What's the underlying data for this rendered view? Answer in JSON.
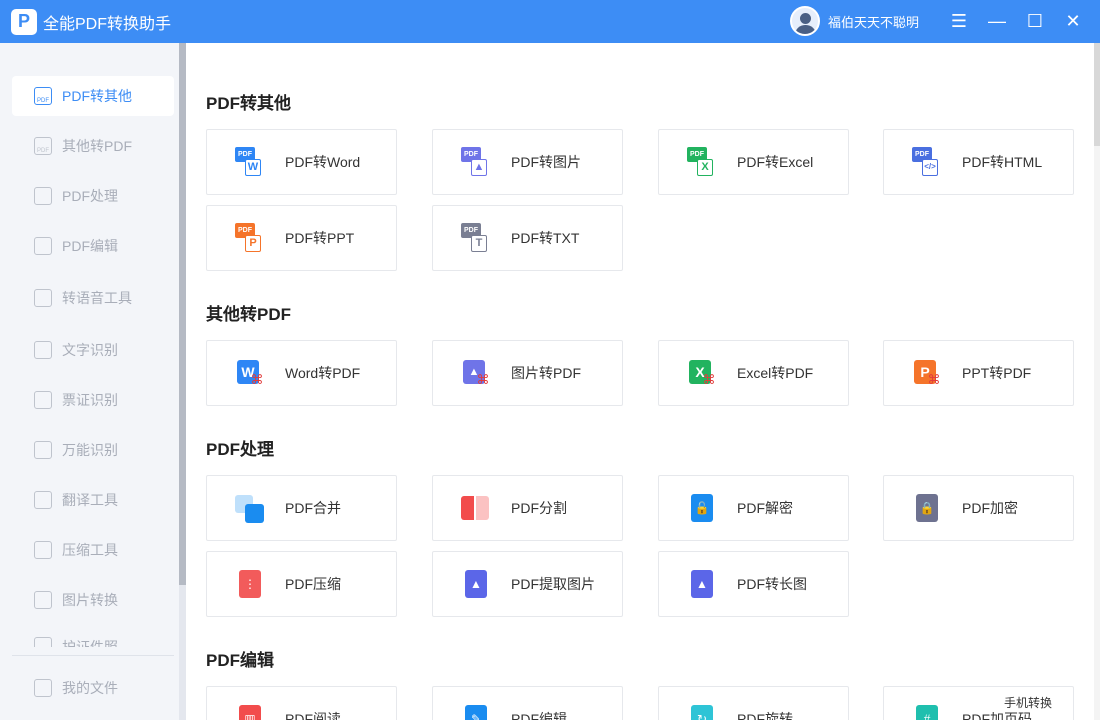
{
  "app": {
    "title": "全能PDF转换助手",
    "logo_letter": "P",
    "accent": "#3d8df5"
  },
  "user": {
    "name": "福伯天天不聪明"
  },
  "window_controls": {
    "menu": "☰",
    "minimize": "—",
    "maximize": "☐",
    "close": "✕"
  },
  "sidebar": {
    "items": [
      {
        "label": "PDF转其他",
        "icon": "pdf-to-other-icon",
        "glyph": "PDF",
        "active": true
      },
      {
        "label": "其他转PDF",
        "icon": "other-to-pdf-icon",
        "glyph": "PDF"
      },
      {
        "label": "PDF处理",
        "icon": "pdf-process-icon",
        "glyph": ""
      },
      {
        "label": "PDF编辑",
        "icon": "pdf-edit-icon",
        "glyph": ""
      },
      {
        "label": "转语音工具",
        "icon": "voice-tool-icon",
        "glyph": ""
      },
      {
        "label": "文字识别",
        "icon": "text-ocr-icon",
        "glyph": ""
      },
      {
        "label": "票证识别",
        "icon": "ticket-ocr-icon",
        "glyph": ""
      },
      {
        "label": "万能识别",
        "icon": "universal-ocr-icon",
        "glyph": ""
      },
      {
        "label": "翻译工具",
        "icon": "translate-icon",
        "glyph": ""
      },
      {
        "label": "压缩工具",
        "icon": "compress-icon",
        "glyph": ""
      },
      {
        "label": "图片转换",
        "icon": "image-convert-icon",
        "glyph": ""
      },
      {
        "label": "护证件照",
        "icon": "id-photo-icon",
        "glyph": ""
      }
    ],
    "my_files": "我的文件"
  },
  "sections": [
    {
      "title": "PDF转其他",
      "cards": [
        {
          "label": "PDF转Word",
          "icon": "pdf-to-word-icon",
          "tag": "PDF",
          "sub": "W",
          "color": "#2e86f5"
        },
        {
          "label": "PDF转图片",
          "icon": "pdf-to-image-icon",
          "tag": "PDF",
          "sub": "▲",
          "color": "#6f74e8"
        },
        {
          "label": "PDF转Excel",
          "icon": "pdf-to-excel-icon",
          "tag": "PDF",
          "sub": "X",
          "color": "#22b35f"
        },
        {
          "label": "PDF转HTML",
          "icon": "pdf-to-html-icon",
          "tag": "PDF",
          "sub": "</>",
          "color": "#4a6fe0"
        },
        {
          "label": "PDF转PPT",
          "icon": "pdf-to-ppt-icon",
          "tag": "PDF",
          "sub": "P",
          "color": "#f5742a"
        },
        {
          "label": "PDF转TXT",
          "icon": "pdf-to-txt-icon",
          "tag": "PDF",
          "sub": "T",
          "color": "#7a7f93"
        }
      ]
    },
    {
      "title": "其他转PDF",
      "cards": [
        {
          "label": "Word转PDF",
          "icon": "word-to-pdf-icon",
          "tag": "W",
          "color": "#2e86f5"
        },
        {
          "label": "图片转PDF",
          "icon": "image-to-pdf-icon",
          "tag": "▲",
          "color": "#6f74e8"
        },
        {
          "label": "Excel转PDF",
          "icon": "excel-to-pdf-icon",
          "tag": "X",
          "color": "#22b35f"
        },
        {
          "label": "PPT转PDF",
          "icon": "ppt-to-pdf-icon",
          "tag": "P",
          "color": "#f5742a"
        }
      ]
    },
    {
      "title": "PDF处理",
      "cards": [
        {
          "label": "PDF合并",
          "icon": "pdf-merge-icon",
          "color": "#1a8cf0"
        },
        {
          "label": "PDF分割",
          "icon": "pdf-split-icon",
          "color": "#f24c4c"
        },
        {
          "label": "PDF解密",
          "icon": "pdf-decrypt-icon",
          "glyph": "🔓",
          "color": "#1a8cf0"
        },
        {
          "label": "PDF加密",
          "icon": "pdf-encrypt-icon",
          "glyph": "🔒",
          "color": "#6e7290"
        },
        {
          "label": "PDF压缩",
          "icon": "pdf-compress-icon",
          "glyph": "⋮",
          "color": "#f25b5b"
        },
        {
          "label": "PDF提取图片",
          "icon": "pdf-extract-image-icon",
          "glyph": "▲",
          "color": "#5b66e8"
        },
        {
          "label": "PDF转长图",
          "icon": "pdf-to-long-image-icon",
          "glyph": "▲",
          "color": "#5b66e8"
        }
      ]
    },
    {
      "title": "PDF编辑",
      "cards": [
        {
          "label": "PDF阅读",
          "icon": "pdf-read-icon",
          "glyph": "▥",
          "color": "#f24c4c"
        },
        {
          "label": "PDF编辑",
          "icon": "pdf-edit-card-icon",
          "glyph": "✎",
          "color": "#1a8cf0"
        },
        {
          "label": "PDF旋转",
          "icon": "pdf-rotate-icon",
          "glyph": "↻",
          "color": "#2ec4d6"
        },
        {
          "label": "PDF加页码",
          "icon": "pdf-page-number-icon",
          "glyph": "#",
          "color": "#1fbfae"
        }
      ]
    }
  ],
  "mobile_convert": "手机转换"
}
